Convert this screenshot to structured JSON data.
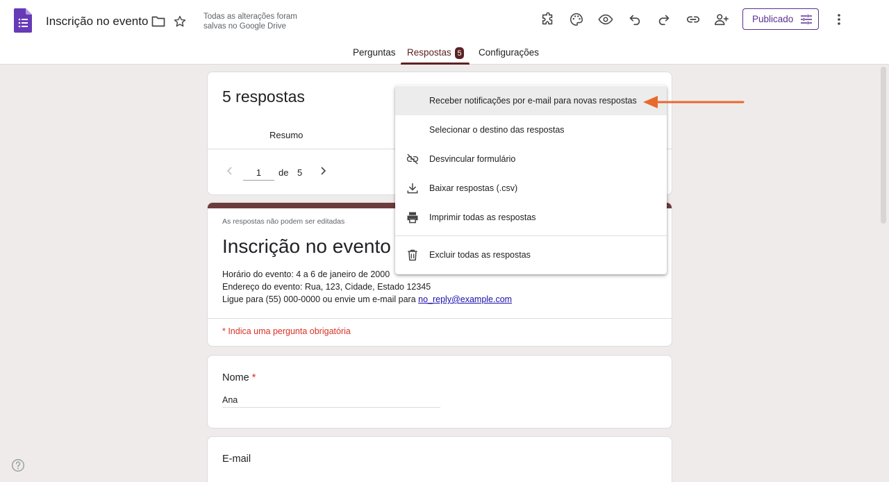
{
  "header": {
    "doc_title": "Inscrição no evento",
    "save_status": "Todas as alterações foram salvas no Google Drive",
    "publish_label": "Publicado",
    "icons": [
      "forms-app-icon",
      "folder-icon",
      "star-icon",
      "addon-icon",
      "palette-icon",
      "preview-icon",
      "undo-icon",
      "redo-icon",
      "link-icon",
      "add-collaborator-icon",
      "settings-sliders-icon",
      "more-vert-icon"
    ]
  },
  "tabs": {
    "questions": "Perguntas",
    "responses": "Respostas",
    "responses_badge": "5",
    "settings": "Configurações"
  },
  "responses_card": {
    "count_title": "5 respostas",
    "summary_tab": "Resumo",
    "pager_current": "1",
    "pager_of": "de",
    "pager_total": "5"
  },
  "menu": {
    "items": [
      {
        "label": "Receber notificações por e-mail para novas respostas"
      },
      {
        "label": "Selecionar o destino das respostas"
      },
      {
        "label": "Desvincular formulário"
      },
      {
        "label": "Baixar respostas (.csv)"
      },
      {
        "label": "Imprimir todas as respostas"
      },
      {
        "label": "Excluir todas as respostas"
      }
    ]
  },
  "form_card": {
    "readonly_note": "As respostas não podem ser editadas",
    "title": "Inscrição no evento",
    "desc_line1": "Horário do evento: 4 a 6 de janeiro de 2000",
    "desc_line2": "Endereço do evento: Rua, 123, Cidade, Estado 12345",
    "desc_line3_prefix": "Ligue para (55) 000-0000 ou envie um e-mail para ",
    "desc_email": "no_reply@example.com",
    "required_note": "* Indica uma pergunta obrigatória"
  },
  "questions": {
    "name_label": "Nome",
    "name_required": "*",
    "name_answer": "Ana",
    "email_label": "E-mail"
  },
  "colors": {
    "accent": "#5c2222",
    "publish": "#5c2d91",
    "arrow": "#e8692e",
    "required": "#d93025"
  }
}
